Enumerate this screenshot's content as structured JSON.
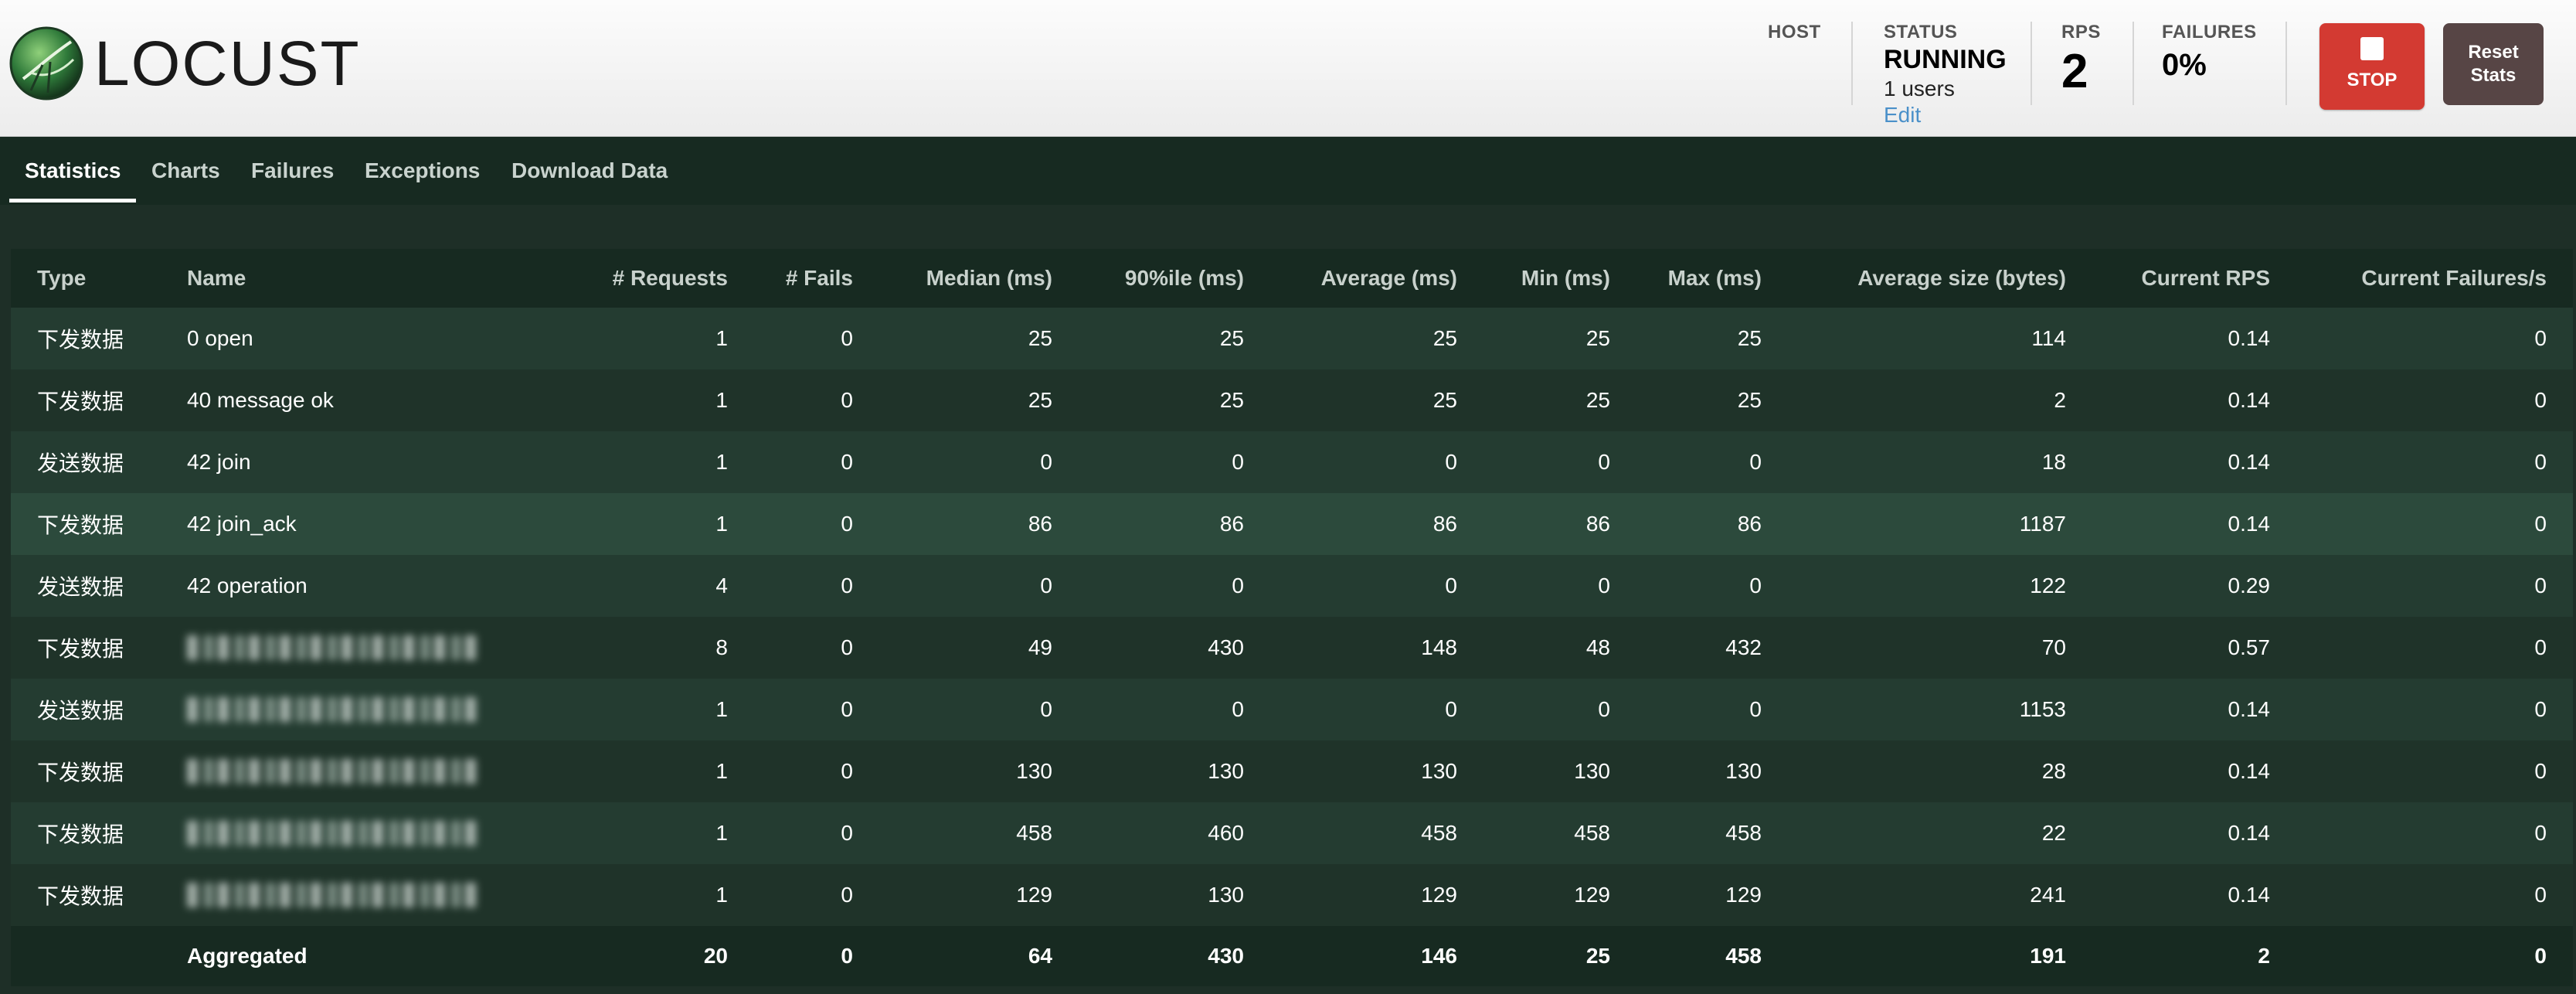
{
  "header": {
    "logo_text": "LOCUST",
    "host_label": "HOST",
    "status_label": "STATUS",
    "status_value": "RUNNING",
    "users": "1 users",
    "edit_label": "Edit",
    "rps_label": "RPS",
    "rps_value": "2",
    "failures_label": "FAILURES",
    "failures_value": "0%",
    "stop_label": "STOP",
    "reset_label_1": "Reset",
    "reset_label_2": "Stats"
  },
  "tabs": [
    {
      "label": "Statistics",
      "active": true
    },
    {
      "label": "Charts"
    },
    {
      "label": "Failures"
    },
    {
      "label": "Exceptions"
    },
    {
      "label": "Download Data"
    }
  ],
  "table": {
    "columns": [
      "Type",
      "Name",
      "# Requests",
      "# Fails",
      "Median (ms)",
      "90%ile (ms)",
      "Average (ms)",
      "Min (ms)",
      "Max (ms)",
      "Average size (bytes)",
      "Current RPS",
      "Current Failures/s"
    ],
    "rows": [
      {
        "type": "下发数据",
        "name": "0 open",
        "requests": "1",
        "fails": "0",
        "median": "25",
        "p90": "25",
        "avg": "25",
        "min": "25",
        "max": "25",
        "size": "114",
        "rps": "0.14",
        "fps": "0"
      },
      {
        "type": "下发数据",
        "name": "40 message ok",
        "requests": "1",
        "fails": "0",
        "median": "25",
        "p90": "25",
        "avg": "25",
        "min": "25",
        "max": "25",
        "size": "2",
        "rps": "0.14",
        "fps": "0"
      },
      {
        "type": "发送数据",
        "name": "42 join",
        "requests": "1",
        "fails": "0",
        "median": "0",
        "p90": "0",
        "avg": "0",
        "min": "0",
        "max": "0",
        "size": "18",
        "rps": "0.14",
        "fps": "0"
      },
      {
        "type": "下发数据",
        "name": "42 join_ack",
        "requests": "1",
        "fails": "0",
        "median": "86",
        "p90": "86",
        "avg": "86",
        "min": "86",
        "max": "86",
        "size": "1187",
        "rps": "0.14",
        "fps": "0"
      },
      {
        "type": "发送数据",
        "name": "42 operation",
        "requests": "4",
        "fails": "0",
        "median": "0",
        "p90": "0",
        "avg": "0",
        "min": "0",
        "max": "0",
        "size": "122",
        "rps": "0.29",
        "fps": "0"
      },
      {
        "type": "下发数据",
        "name": "",
        "requests": "8",
        "fails": "0",
        "median": "49",
        "p90": "430",
        "avg": "148",
        "min": "48",
        "max": "432",
        "size": "70",
        "rps": "0.57",
        "fps": "0"
      },
      {
        "type": "发送数据",
        "name": "",
        "requests": "1",
        "fails": "0",
        "median": "0",
        "p90": "0",
        "avg": "0",
        "min": "0",
        "max": "0",
        "size": "1153",
        "rps": "0.14",
        "fps": "0"
      },
      {
        "type": "下发数据",
        "name": "",
        "requests": "1",
        "fails": "0",
        "median": "130",
        "p90": "130",
        "avg": "130",
        "min": "130",
        "max": "130",
        "size": "28",
        "rps": "0.14",
        "fps": "0"
      },
      {
        "type": "下发数据",
        "name": "",
        "requests": "1",
        "fails": "0",
        "median": "458",
        "p90": "460",
        "avg": "458",
        "min": "458",
        "max": "458",
        "size": "22",
        "rps": "0.14",
        "fps": "0"
      },
      {
        "type": "下发数据",
        "name": "",
        "requests": "1",
        "fails": "0",
        "median": "129",
        "p90": "130",
        "avg": "129",
        "min": "129",
        "max": "129",
        "size": "241",
        "rps": "0.14",
        "fps": "0"
      }
    ],
    "aggregated": {
      "type": "",
      "name": "Aggregated",
      "requests": "20",
      "fails": "0",
      "median": "64",
      "p90": "430",
      "avg": "146",
      "min": "25",
      "max": "458",
      "size": "191",
      "rps": "2",
      "fps": "0"
    }
  },
  "colors": {
    "background": "#1e2f27",
    "stop_button": "#d33a32",
    "reset_button": "#574545",
    "edit_link": "#4a90c9"
  }
}
